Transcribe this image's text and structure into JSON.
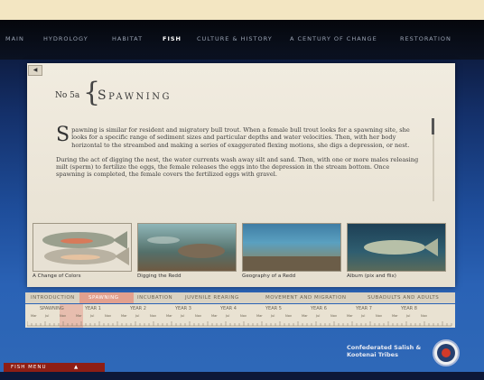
{
  "nav": {
    "items": [
      {
        "label": "MAIN",
        "active": false
      },
      {
        "label": "HYDROLOGY",
        "active": false
      },
      {
        "label": "HABITAT",
        "active": false
      },
      {
        "label": "FISH",
        "active": true
      },
      {
        "label": "CULTURE & HISTORY",
        "active": false
      },
      {
        "label": "A CENTURY OF CHANGE",
        "active": false
      },
      {
        "label": "RESTORATION",
        "active": false
      }
    ]
  },
  "back_label": "◀",
  "section": {
    "number": "No 5a",
    "brace": "{",
    "title": "Spawning"
  },
  "body": {
    "drop_cap": "S",
    "p1_rest": "pawning is similar for resident and migratory bull trout. When a female bull trout looks for a spawning site, she looks for a specific range of sediment sizes and particular depths and water velocities. Then, with her body horizontal to the streambed and making a series of exaggerated flexing motions, she digs a depression, or nest.",
    "p2": "During the act of digging the nest, the water currents wash away silt and sand. Then, with one or more males releasing milt (sperm) to fertilize the eggs, the female releases the eggs into the depression in the stream bottom. Once spawning is completed, the female covers the fertilized eggs with gravel."
  },
  "thumbnails": [
    {
      "caption": "A Change of Colors"
    },
    {
      "caption": "Digging the Redd"
    },
    {
      "caption": "Geography of a Redd"
    },
    {
      "caption": "Album (pix and flix)"
    }
  ],
  "tabs": [
    {
      "label": "INTRODUCTION",
      "active": false
    },
    {
      "label": "SPAWNING",
      "active": true
    },
    {
      "label": "INCUBATION",
      "active": false
    },
    {
      "label": "JUVENILE REARING",
      "active": false
    },
    {
      "label": "MOVEMENT AND MIGRATION",
      "active": false
    },
    {
      "label": "SUBADULTS AND ADULTS",
      "active": false
    }
  ],
  "timeline": {
    "years": [
      "SPAWNING",
      "YEAR 1",
      "YEAR 2",
      "YEAR 3",
      "YEAR 4",
      "YEAR 5",
      "YEAR 6",
      "YEAR 7",
      "YEAR 8"
    ],
    "months": [
      "Mar",
      "Jul",
      "Nov"
    ]
  },
  "logo_text": "Confederated Salish & Kootenai Tribes",
  "fish_menu": {
    "label": "FISH MENU",
    "arrow": "▲"
  }
}
